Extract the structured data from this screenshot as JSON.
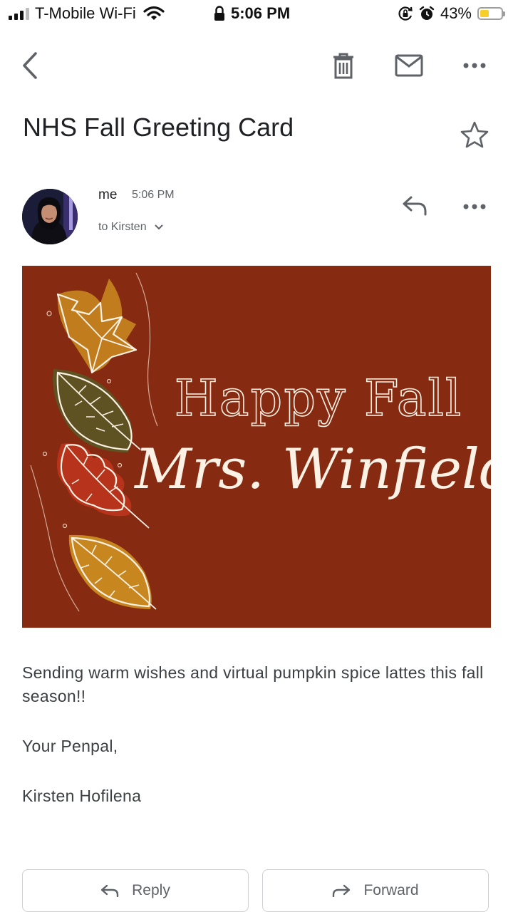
{
  "status_bar": {
    "carrier": "T-Mobile Wi-Fi",
    "time": "5:06 PM",
    "battery_percent": "43%",
    "battery_level": 0.43,
    "battery_color": "#f7cf2a"
  },
  "toolbar": {
    "back_icon": "chevron-left-icon",
    "delete_icon": "trash-icon",
    "mark_unread_icon": "envelope-icon",
    "more_icon": "more-horizontal-icon"
  },
  "email": {
    "subject": "NHS Fall Greeting Card",
    "sender": "me",
    "time": "5:06 PM",
    "recipient": "to Kirsten",
    "card": {
      "line1": "Happy Fall",
      "line2": "Mrs. Winfield",
      "background": "#862a11"
    },
    "body": [
      "Sending warm wishes and virtual pumpkin spice lattes this fall season!!",
      "Your Penpal,",
      "Kirsten Hofilena"
    ]
  },
  "actions": {
    "reply": "Reply",
    "forward": "Forward"
  }
}
